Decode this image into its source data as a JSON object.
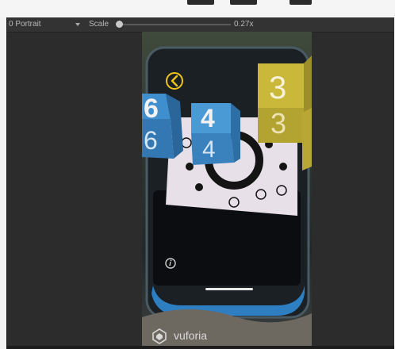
{
  "toolbar": {
    "aspect_label": "0 Portrait",
    "scale_label": "Scale",
    "scale_value": "0.27x"
  },
  "scene": {
    "cubes": [
      {
        "front": "6",
        "side": "6"
      },
      {
        "front": "4",
        "side": "4"
      },
      {
        "front": "3",
        "side": "3"
      }
    ],
    "brand": "vuforia"
  },
  "colors": {
    "editor_bg": "#2c2c2c",
    "cube_blue": "#3f8fcf",
    "cube_yellow": "#c9b83a",
    "marker_bg": "#e6dde6"
  }
}
